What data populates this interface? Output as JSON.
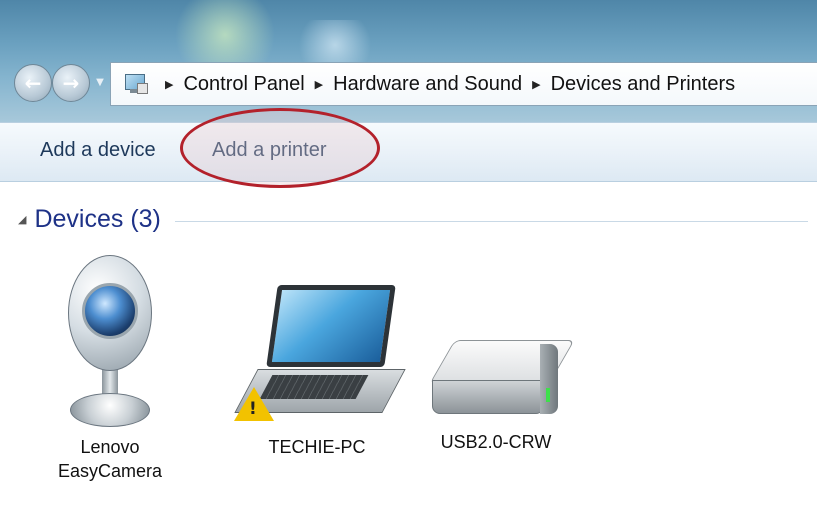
{
  "breadcrumb": {
    "items": [
      "Control Panel",
      "Hardware and Sound",
      "Devices and Printers"
    ]
  },
  "toolbar": {
    "add_device_label": "Add a device",
    "add_printer_label": "Add a printer"
  },
  "devices_group": {
    "title": "Devices (3)",
    "items": [
      {
        "label_line1": "Lenovo",
        "label_line2": "EasyCamera",
        "icon": "webcam-icon"
      },
      {
        "label_line1": "TECHIE-PC",
        "icon": "laptop-icon",
        "status": "warning"
      },
      {
        "label_line1": "USB2.0-CRW",
        "icon": "external-drive-icon"
      }
    ]
  },
  "colors": {
    "group_title": "#1e3287",
    "command_text": "#1e395b",
    "highlight_ring": "#b3212b",
    "warning": "#f2c200"
  }
}
